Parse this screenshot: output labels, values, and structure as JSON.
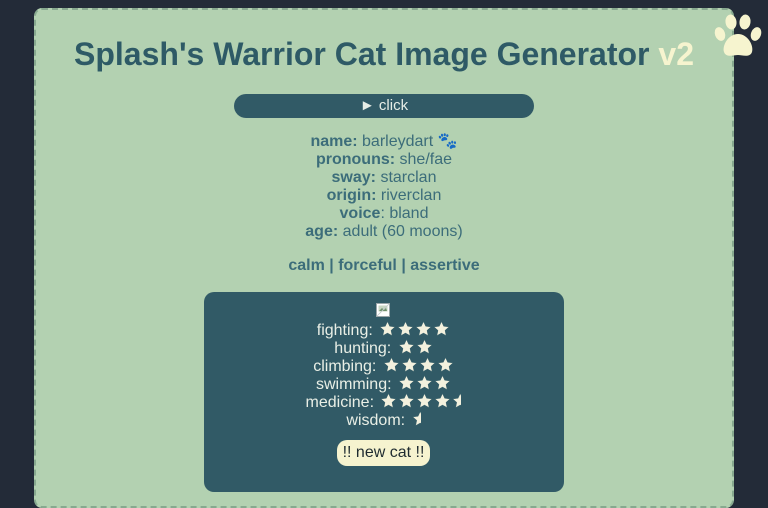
{
  "header": {
    "title": "Splash's Warrior Cat Image Generator",
    "version": "v2"
  },
  "toggle": {
    "label": "► click"
  },
  "cat": {
    "name_label": "name:",
    "name_value": "barleydart 🐾",
    "pronouns_label": "pronouns:",
    "pronouns_value": "she/fae",
    "sway_label": "sway:",
    "sway_value": "starclan",
    "origin_label": "origin:",
    "origin_value": "riverclan",
    "voice_label": "voice",
    "voice_value": ": bland",
    "age_label": "age:",
    "age_value": "adult (60 moons)"
  },
  "traits": [
    "calm",
    "forceful",
    "assertive"
  ],
  "trait_separator": " | ",
  "skills": [
    {
      "label": "fighting:",
      "stars": 4
    },
    {
      "label": "hunting:",
      "stars": 2
    },
    {
      "label": "climbing:",
      "stars": 4
    },
    {
      "label": "swimming:",
      "stars": 3
    },
    {
      "label": "medicine:",
      "stars": 4.5
    },
    {
      "label": "wisdom:",
      "stars": 0.5
    }
  ],
  "new_cat_button": "!! new cat !!",
  "colors": {
    "background": "#232b38",
    "panel": "#b3d1b1",
    "accent": "#315a66",
    "title": "#2e5a66",
    "version": "#f6f4cf"
  },
  "icons": {
    "corner": "paw-icon",
    "image": "broken-image-icon",
    "rating": "star-icon"
  }
}
